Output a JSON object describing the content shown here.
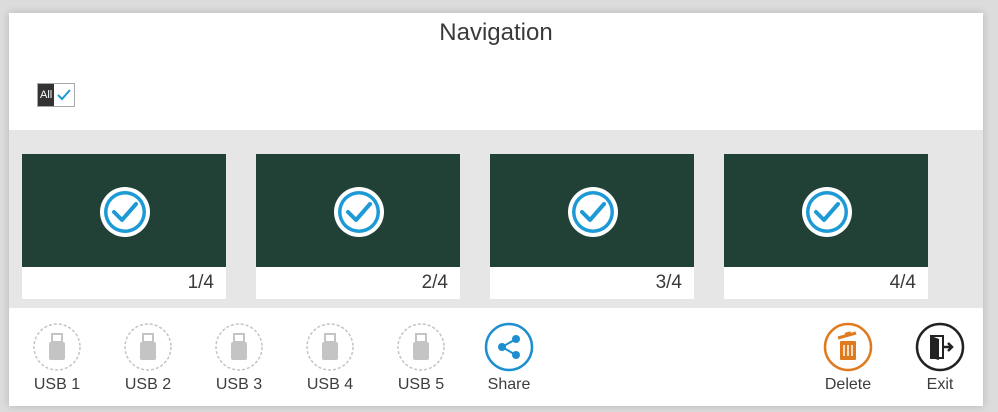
{
  "title": "Navigation",
  "select_all": {
    "label": "All",
    "checked": true
  },
  "thumbnails": [
    {
      "label": "1/4",
      "selected": true
    },
    {
      "label": "2/4",
      "selected": true
    },
    {
      "label": "3/4",
      "selected": true
    },
    {
      "label": "4/4",
      "selected": true
    }
  ],
  "toolbar": {
    "usb1": "USB 1",
    "usb2": "USB 2",
    "usb3": "USB 3",
    "usb4": "USB 4",
    "usb5": "USB 5",
    "share": "Share",
    "delete": "Delete",
    "exit": "Exit"
  },
  "colors": {
    "thumbnail_bg": "#224136",
    "check_blue": "#1d9ad6",
    "share_blue": "#1d8fd0",
    "delete_orange": "#e07a1f",
    "usb_gray": "#bdbdbd"
  }
}
